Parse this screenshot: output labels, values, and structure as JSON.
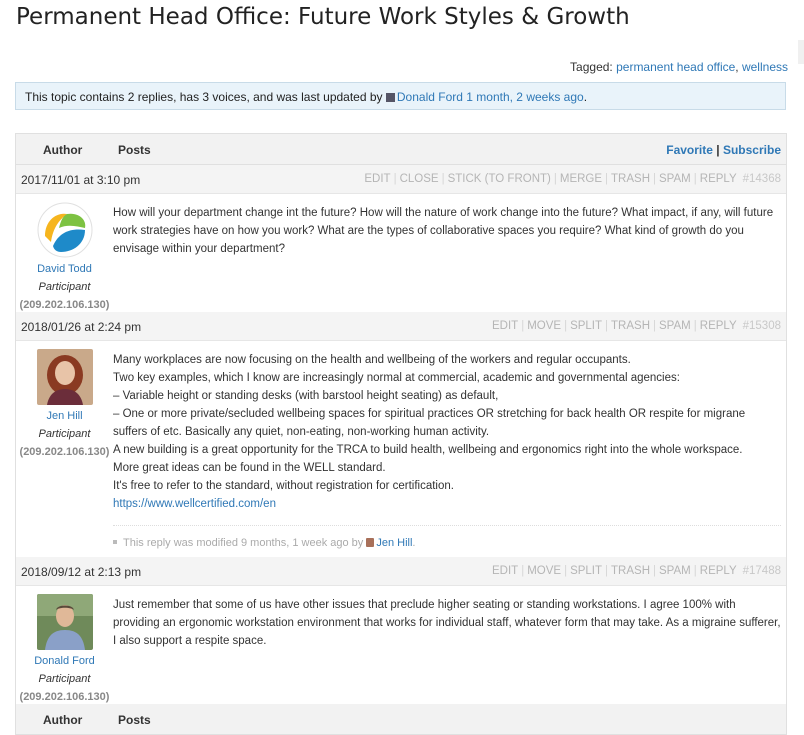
{
  "topic": {
    "title": "Permanent Head Office: Future Work Styles & Growth",
    "tagged_label": "Tagged: ",
    "tags": [
      "permanent head office",
      "wellness"
    ],
    "notice_prefix": "This topic contains 2 replies, has 3 voices, and was last updated by",
    "notice_user": "Donald Ford",
    "notice_time": "1 month, 2 weeks ago",
    "notice_suffix": "."
  },
  "header": {
    "author": "Author",
    "posts": "Posts",
    "favorite": "Favorite",
    "separator": "|",
    "subscribe": "Subscribe"
  },
  "footer_header": {
    "author": "Author",
    "posts": "Posts"
  },
  "posts": [
    {
      "date": "2017/11/01 at 3:10 pm",
      "admin": [
        "EDIT",
        "CLOSE",
        "STICK (TO FRONT)",
        "MERGE",
        "TRASH",
        "SPAM",
        "REPLY"
      ],
      "id": "#14368",
      "author": "David Todd",
      "role": "Participant",
      "ip": "(209.202.106.130)",
      "lines": [
        "How will your department change int the future? How will the nature of work change into the future? What impact, if any, will future work strategies have on how you work? What are the types of collaborative spaces you require? What kind of growth do you envisage within your department?"
      ]
    },
    {
      "date": "2018/01/26 at 2:24 pm",
      "admin": [
        "EDIT",
        "MOVE",
        "SPLIT",
        "TRASH",
        "SPAM",
        "REPLY"
      ],
      "id": "#15308",
      "author": "Jen Hill",
      "role": "Participant",
      "ip": "(209.202.106.130)",
      "lines": [
        "Many workplaces are now focusing on the health and wellbeing of the workers and regular occupants.",
        "Two key examples, which I know are increasingly normal at commercial, academic and governmental agencies:",
        "– Variable height or standing desks (with barstool height seating) as default,",
        "– One or more private/secluded wellbeing spaces for spiritual practices OR stretching for back health OR respite for migrane suffers of etc. Basically any quiet, non-eating, non-working human activity.",
        "A new building is a great opportunity for the TRCA to build health, wellbeing and ergonomics right into the whole workspace.",
        "More great ideas can be found in the WELL standard.",
        "It's free to refer to the standard, without registration for certification."
      ],
      "link": "https://www.wellcertified.com/en",
      "revision_prefix": "This reply was modified 9 months, 1 week ago by",
      "revision_user": "Jen Hill",
      "revision_suffix": "."
    },
    {
      "date": "2018/09/12 at 2:13 pm",
      "admin": [
        "EDIT",
        "MOVE",
        "SPLIT",
        "TRASH",
        "SPAM",
        "REPLY"
      ],
      "id": "#17488",
      "author": "Donald Ford",
      "role": "Participant",
      "ip": "(209.202.106.130)",
      "lines": [
        "Just remember that some of us have other issues that preclude higher seating or standing workstations. I agree 100% with providing an ergonomic workstation environment that works for individual staff, whatever form that may take. As a migraine sufferer, I also support a respite space."
      ]
    }
  ],
  "colors": {
    "link": "#2f78b6",
    "notice_bg": "#e9f3fa",
    "admin_link": "#b5b5b5"
  }
}
